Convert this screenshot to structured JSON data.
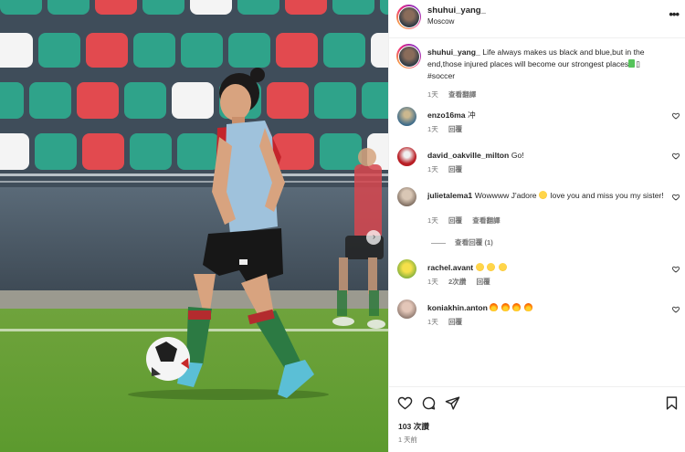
{
  "post": {
    "username": "shuhui_yang_",
    "location": "Moscow",
    "caption": "Life always makes us black and blue,but in the end,those injured places will become our strongest places",
    "hashtag": "#soccer",
    "time": "1天",
    "translate_label": "查看翻譯"
  },
  "comments": [
    {
      "username": "enzo16ma",
      "text": "冲",
      "time": "1天",
      "reply_label": "回覆"
    },
    {
      "username": "david_oakville_milton",
      "text": "Go!",
      "time": "1天",
      "reply_label": "回覆"
    },
    {
      "username": "julietalema1",
      "text_before": "Wowwww J'adore",
      "text_after": "love you and miss you my sister!",
      "time": "1天",
      "reply_label": "回覆",
      "translate_label": "查看翻譯",
      "view_replies": "查看回覆 (1)"
    },
    {
      "username": "rachel.avant",
      "time": "1天",
      "likes": "2次讚",
      "reply_label": "回覆"
    },
    {
      "username": "koniakhin.anton",
      "time": "1天",
      "reply_label": "回覆"
    }
  ],
  "footer": {
    "likes": "103 次讚",
    "time": "1 天前"
  },
  "icons": {
    "more": "more-icon",
    "heart": "heart-icon",
    "comment": "comment-icon",
    "share": "share-icon",
    "save": "bookmark-icon",
    "next": "chevron-right-icon"
  },
  "colors": {
    "text": "#262626",
    "secondary": "#737373",
    "hashtag": "#00376b",
    "border": "#efefef"
  }
}
